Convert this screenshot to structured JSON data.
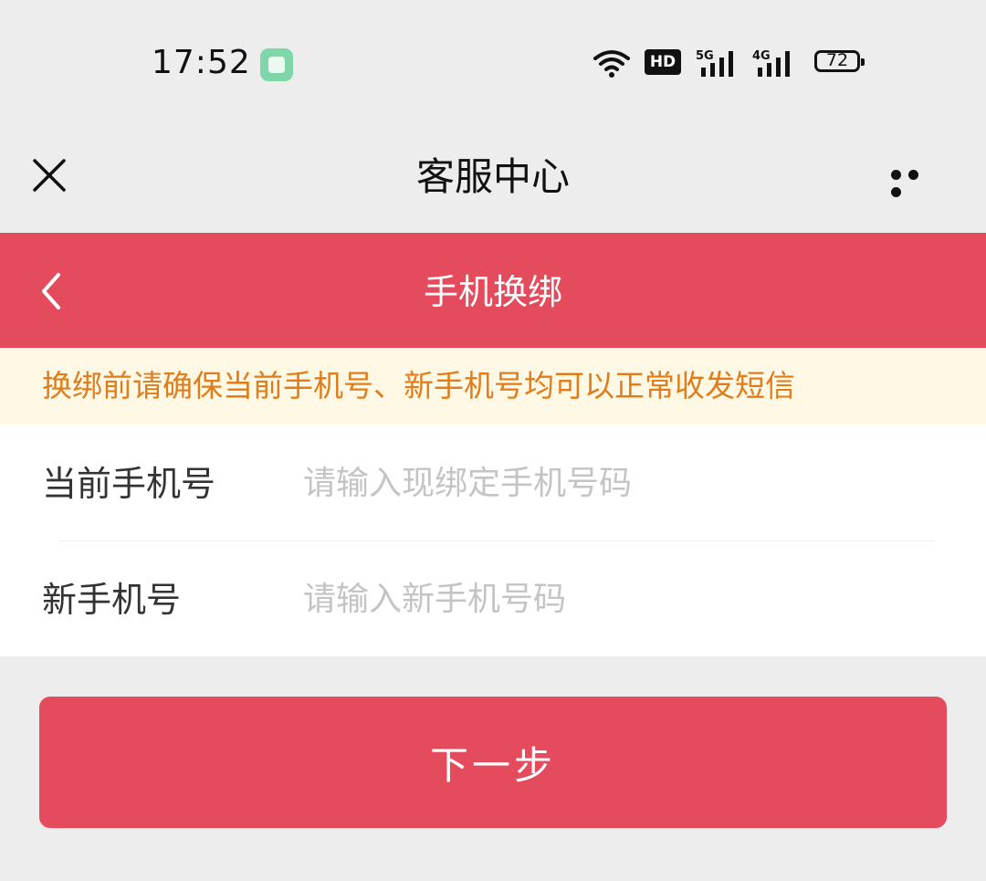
{
  "status_bar": {
    "time": "17:52",
    "network_badge": "HD",
    "network_5g": "5G",
    "network_4g": "4G",
    "battery": "72"
  },
  "mini_program_header": {
    "title": "客服中心"
  },
  "page_header": {
    "title": "手机换绑"
  },
  "notice": {
    "text": "换绑前请确保当前手机号、新手机号均可以正常收发短信"
  },
  "form": {
    "current_phone": {
      "label": "当前手机号",
      "placeholder": "请输入现绑定手机号码",
      "value": ""
    },
    "new_phone": {
      "label": "新手机号",
      "placeholder": "请输入新手机号码",
      "value": ""
    }
  },
  "actions": {
    "next_label": "下一步"
  },
  "colors": {
    "accent": "#e44b5d",
    "notice_bg": "#fff8e4",
    "notice_text": "#e07d1a",
    "page_bg": "#ededed"
  }
}
